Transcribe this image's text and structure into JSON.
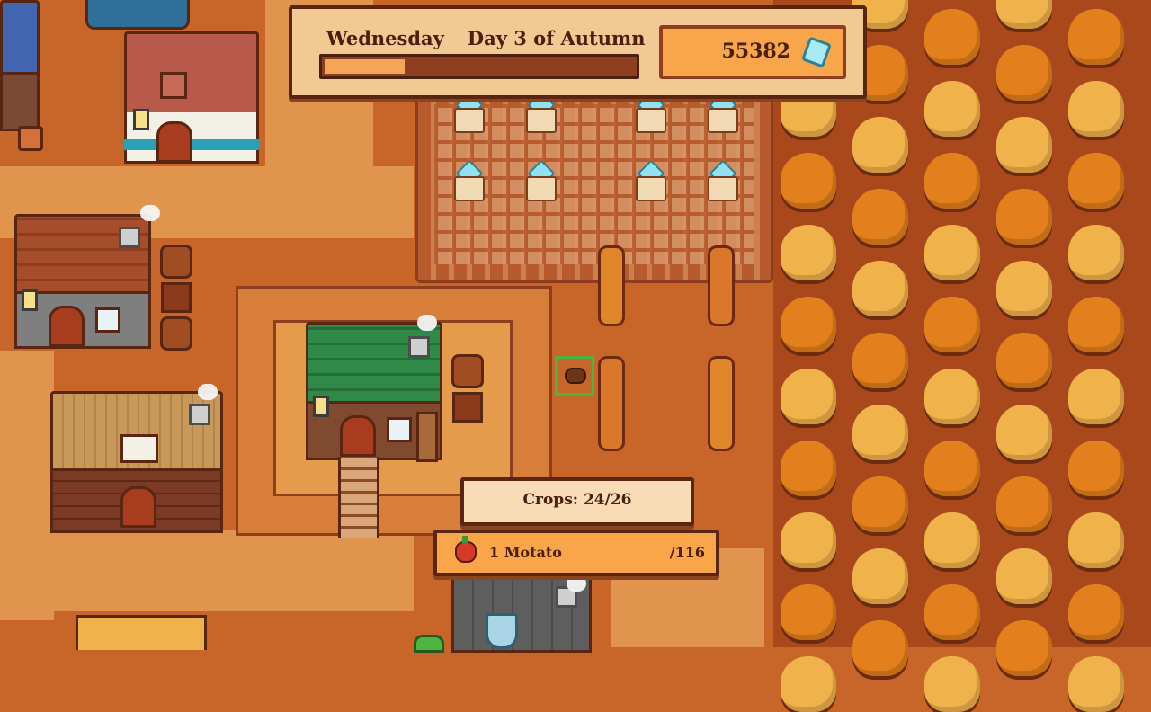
{
  "hud": {
    "day_name": "Wednesday",
    "date": "Day 3 of Autumn",
    "day_progress": 0.26,
    "money": "55382",
    "money_icon": "gem-icon"
  },
  "crops_panel": {
    "label": "Crops: 24/26"
  },
  "item_panel": {
    "icon": "motato-icon",
    "name": "1 Motato",
    "total": "/116"
  },
  "colors": {
    "ground": "#c8662a",
    "hud_bg": "#f2c893",
    "accent_orange": "#f9a64a",
    "border_brown": "#5a2612",
    "selection_green": "#4bb540"
  }
}
